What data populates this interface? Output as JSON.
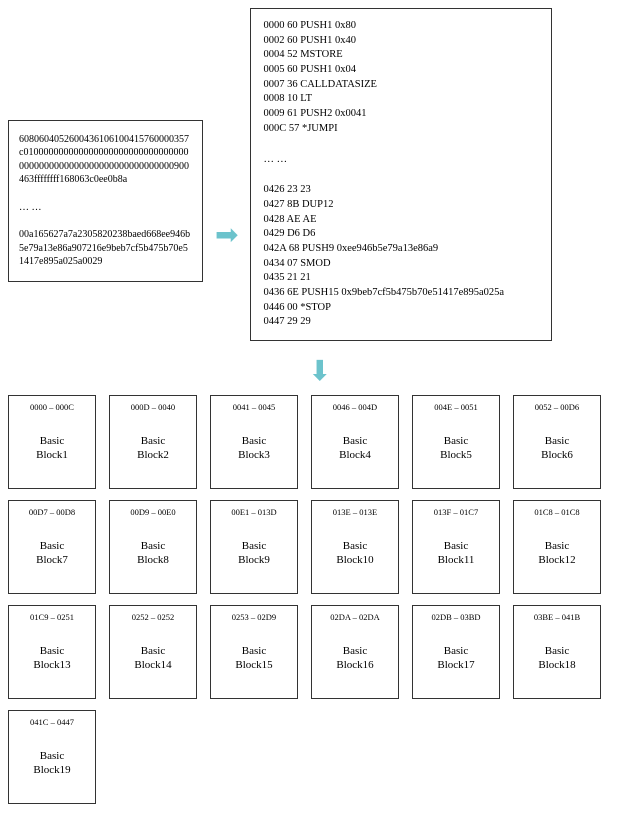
{
  "hex": {
    "top": "6080604052600436106100415760000357c0100000000000000000000000000000000000000000000000000000000000000900463ffffffff168063c0ee0b8a",
    "ellipsis": "… …",
    "bottom": "00a165627a7a2305820238baed668ee946b5e79a13e86a907216e9beb7cf5b475b70e51417e895a025a0029"
  },
  "opcodes": {
    "section1": [
      "0000 60 PUSH1 0x80",
      "0002 60 PUSH1 0x40",
      "0004 52 MSTORE",
      "0005 60 PUSH1 0x04",
      "0007 36 CALLDATASIZE",
      "0008 10 LT",
      "0009 61 PUSH2 0x0041",
      "000C 57 *JUMPI"
    ],
    "ellipsis": "… …",
    "section2": [
      "0426 23 23",
      "0427 8B DUP12",
      "0428 AE AE",
      "0429 D6 D6",
      "042A 68 PUSH9 0xee946b5e79a13e86a9",
      "0434 07 SMOD",
      "0435 21 21",
      "0436 6E PUSH15 0x9beb7cf5b475b70e51417e895a025a",
      "0446 00 *STOP",
      "0447 29 29"
    ]
  },
  "blocks": [
    {
      "range": "0000 – 000C",
      "label1": "Basic",
      "label2": "Block1"
    },
    {
      "range": "000D – 0040",
      "label1": "Basic",
      "label2": "Block2"
    },
    {
      "range": "0041 – 0045",
      "label1": "Basic",
      "label2": "Block3"
    },
    {
      "range": "0046 – 004D",
      "label1": "Basic",
      "label2": "Block4"
    },
    {
      "range": "004E – 0051",
      "label1": "Basic",
      "label2": "Block5"
    },
    {
      "range": "0052 – 00D6",
      "label1": "Basic",
      "label2": "Block6"
    },
    {
      "range": "00D7 – 00D8",
      "label1": "Basic",
      "label2": "Block7"
    },
    {
      "range": "00D9 – 00E0",
      "label1": "Basic",
      "label2": "Block8"
    },
    {
      "range": "00E1 – 013D",
      "label1": "Basic",
      "label2": "Block9"
    },
    {
      "range": "013E – 013E",
      "label1": "Basic",
      "label2": "Block10"
    },
    {
      "range": "013F – 01C7",
      "label1": "Basic",
      "label2": "Block11"
    },
    {
      "range": "01C8 – 01C8",
      "label1": "Basic",
      "label2": "Block12"
    },
    {
      "range": "01C9 – 0251",
      "label1": "Basic",
      "label2": "Block13"
    },
    {
      "range": "0252 – 0252",
      "label1": "Basic",
      "label2": "Block14"
    },
    {
      "range": "0253 – 02D9",
      "label1": "Basic",
      "label2": "Block15"
    },
    {
      "range": "02DA – 02DA",
      "label1": "Basic",
      "label2": "Block16"
    },
    {
      "range": "02DB – 03BD",
      "label1": "Basic",
      "label2": "Block17"
    },
    {
      "range": "03BE – 041B",
      "label1": "Basic",
      "label2": "Block18"
    },
    {
      "range": "041C – 0447",
      "label1": "Basic",
      "label2": "Block19"
    }
  ]
}
